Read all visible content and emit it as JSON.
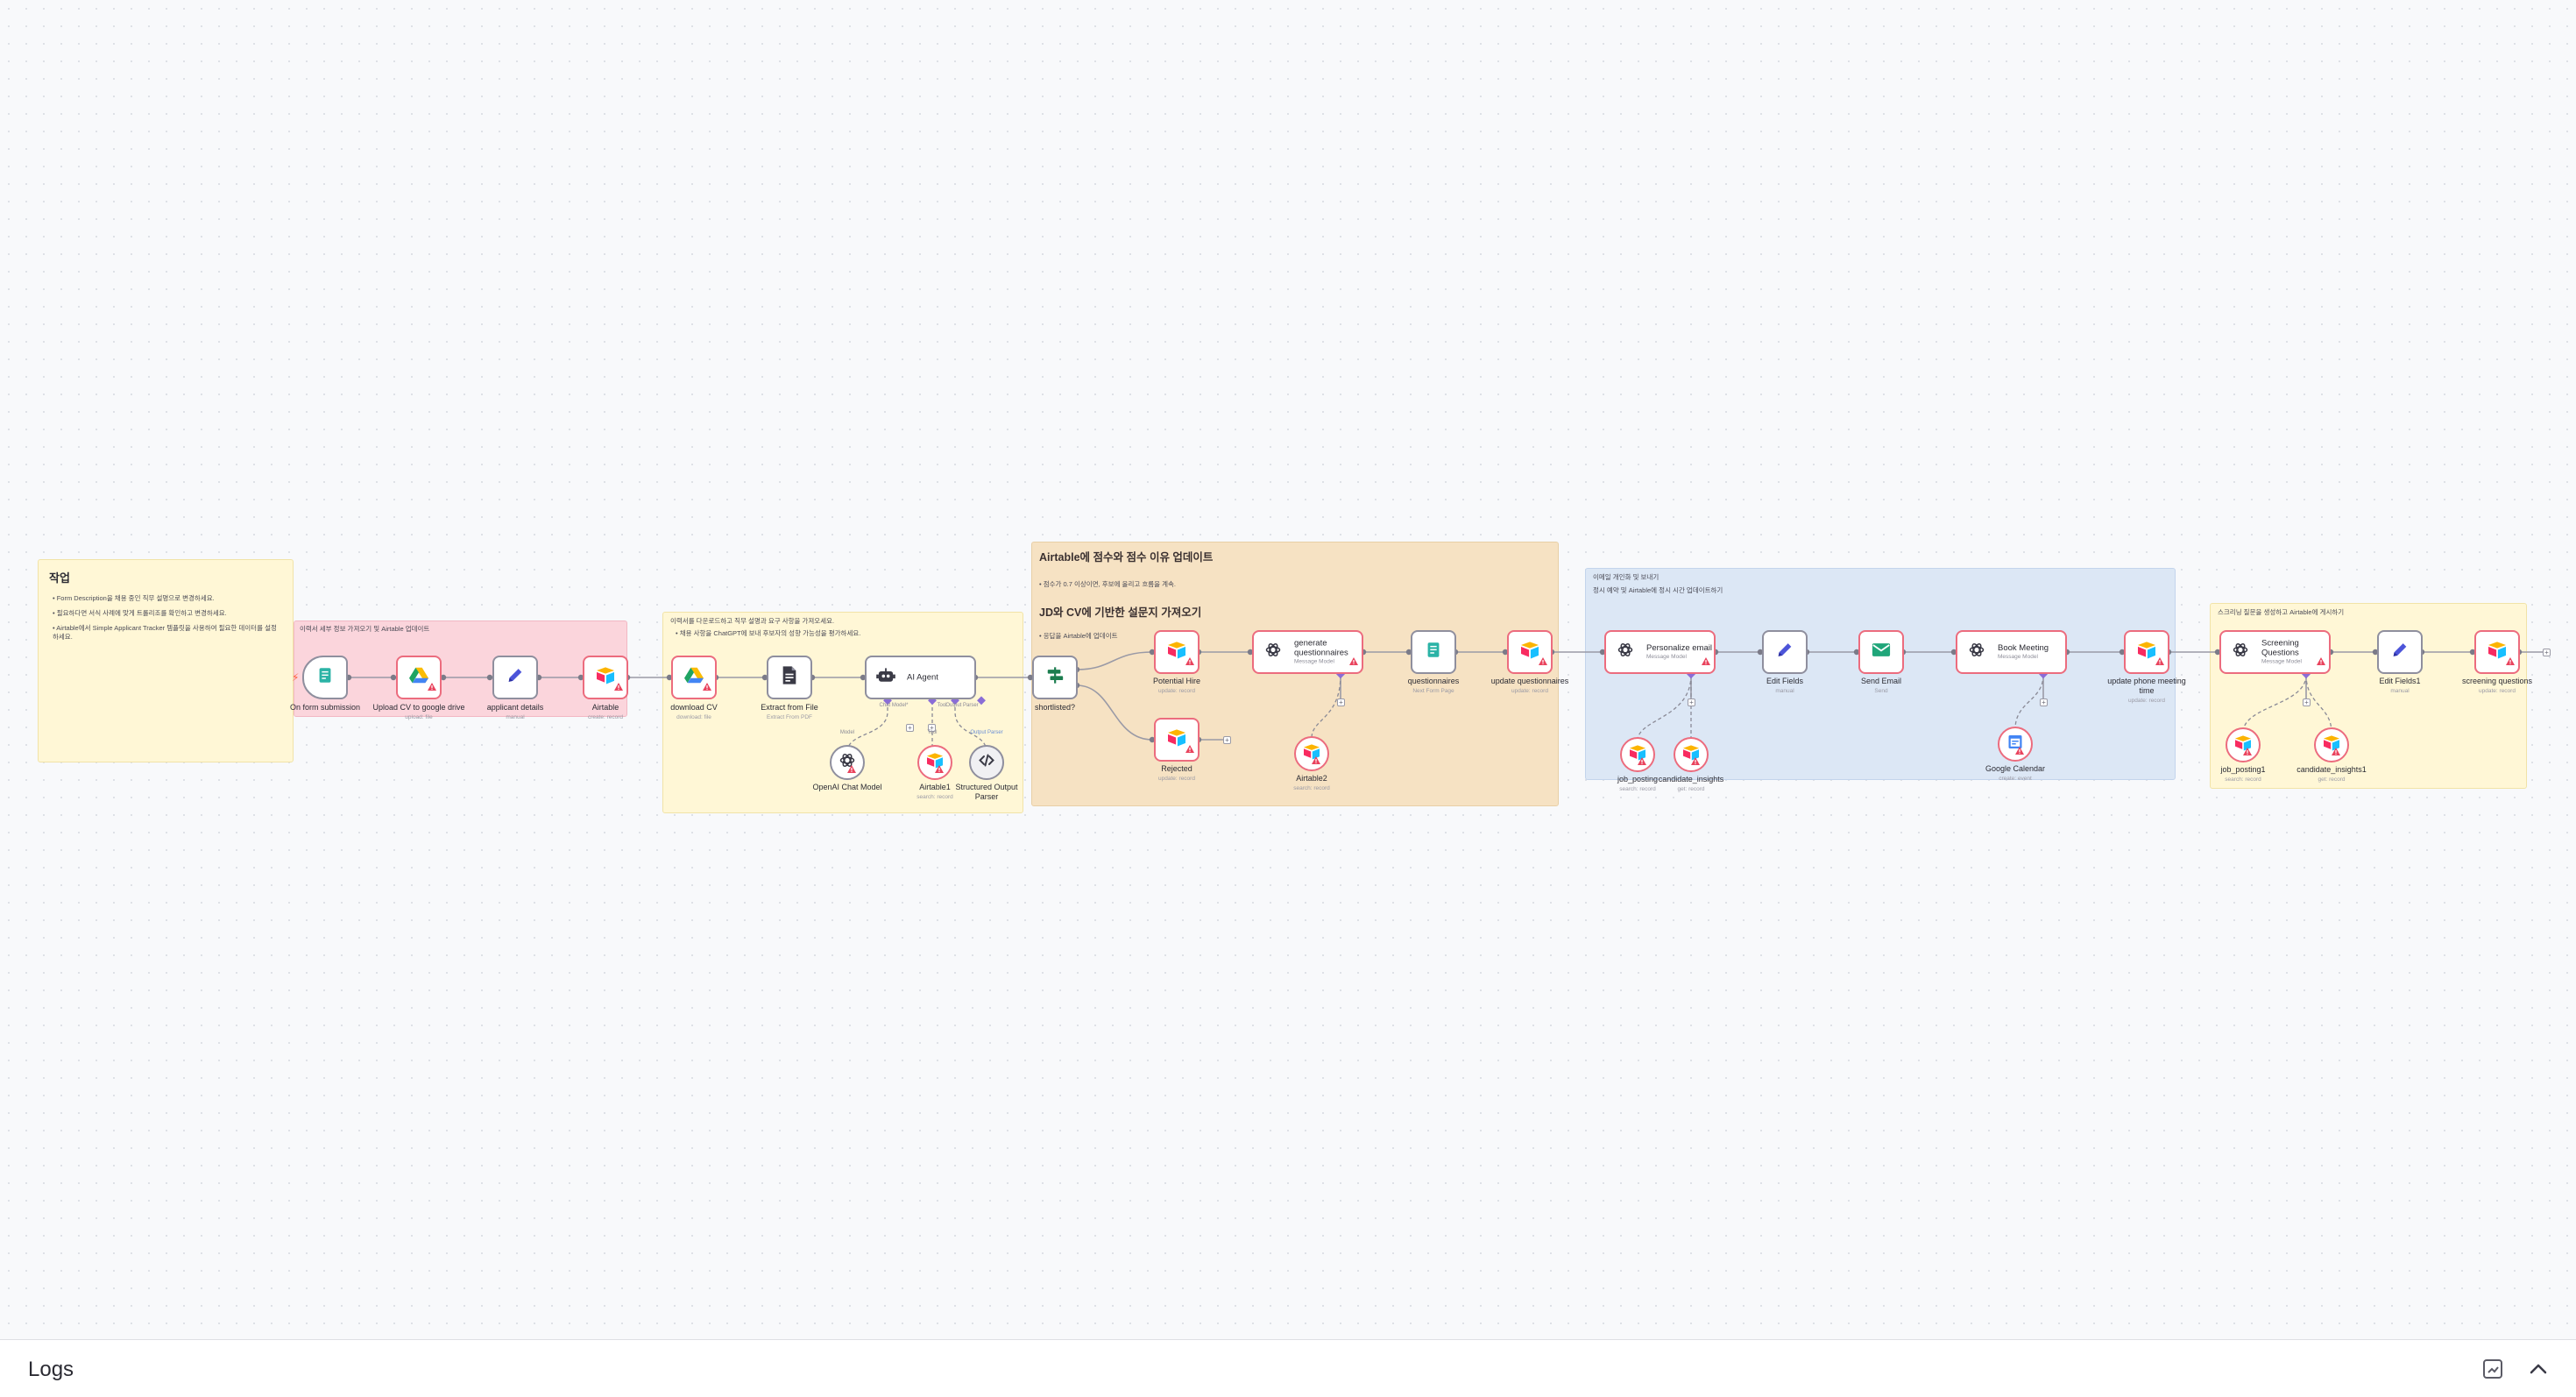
{
  "canvas": {
    "sticky_notes": {
      "s1": {
        "title": "작업",
        "lines": [
          "Form Description을 채용 중인 직무 설명으로 변경하세요.",
          "필요하다면 서식 사례에 맞게 트롤리조를 확인하고 변경하세요.",
          "Airtable에서 Simple Applicant Tracker 템플릿을 사용하여 필요한 데이터를 설정하세요."
        ]
      },
      "s2": {
        "lines": [
          "이력서 세부 정보 가져오기 및 Airtable 업데이트"
        ]
      },
      "s3": {
        "lines": [
          "이력서를 다운로드하고 직무 설명과 요구 사항을 가져오세요.",
          "• 채용 사항을 ChatGPT에 보내 후보자의 성향 가능성을 평가하세요."
        ]
      },
      "s4": {
        "title": "Airtable에 점수와 점수 이유 업데이트",
        "line1": "• 점수가 0.7 이상이면, 후보에 올리고 흐름을 계속.",
        "title2": "JD와 CV에 기반한 설문지 가져오기",
        "line2": "• 응답을 Airtable에 업데이트"
      },
      "s5": {
        "lines": [
          "이메일 개인화 및 보내기",
          "정시 예약 및 Airtable에 정시 시간 업데이트하기"
        ]
      },
      "s6": {
        "lines": [
          "스크리닝 질문을 생성하고 Airtable에 게시하기"
        ]
      }
    },
    "nodes": {
      "on_form": {
        "label": "On form submission",
        "icon": "form-icon"
      },
      "upload_cv": {
        "label": "Upload CV to google drive",
        "sub": "upload: file",
        "icon": "google-drive-icon"
      },
      "applicant_details": {
        "label": "applicant details",
        "sub": "manual",
        "icon": "pencil-icon"
      },
      "airtable": {
        "label": "Airtable",
        "sub": "create: record",
        "icon": "airtable-icon"
      },
      "download_cv": {
        "label": "download CV",
        "sub": "download: file",
        "icon": "google-drive-icon"
      },
      "extract_pdf": {
        "label": "Extract from File",
        "sub": "Extract From PDF",
        "icon": "file-extract-icon"
      },
      "ai_agent": {
        "label": "AI Agent",
        "icon": "robot-icon",
        "port_model": "Chat Model*",
        "port_tool": "Tool",
        "port_output": "Output Parser"
      },
      "openai_chat": {
        "label": "OpenAI Chat Model",
        "icon": "openai-icon",
        "port": "Model"
      },
      "airtable1": {
        "label": "Airtable1",
        "sub": "search: record",
        "icon": "airtable-icon",
        "port": "Tool"
      },
      "parser": {
        "label": "Structured Output Parser",
        "icon": "code-icon",
        "port": "Output Parser"
      },
      "shortlisted": {
        "label": "shortlisted?",
        "icon": "switch-icon"
      },
      "potential_hire": {
        "label": "Potential Hire",
        "sub": "update: record",
        "icon": "airtable-icon"
      },
      "rejected": {
        "label": "Rejected",
        "sub": "update: record",
        "icon": "airtable-icon"
      },
      "gen_questionnaires": {
        "label": "generate questionnaires",
        "sub": "Message Model",
        "icon": "openai-icon"
      },
      "airtable2": {
        "label": "Airtable2",
        "sub": "search: record",
        "icon": "airtable-icon"
      },
      "questionnaires": {
        "label": "questionnaires",
        "sub": "Next Form Page",
        "icon": "form-icon"
      },
      "update_questionnaires": {
        "label": "update questionnaires",
        "sub": "update: record",
        "icon": "airtable-icon"
      },
      "personalize_email": {
        "label": "Personalize email",
        "sub": "Message Model",
        "icon": "openai-icon"
      },
      "job_posting": {
        "label": "job_posting",
        "sub": "search: record",
        "icon": "airtable-icon"
      },
      "candidate_insights": {
        "label": "candidate_insights",
        "sub": "get: record",
        "icon": "airtable-icon"
      },
      "edit_fields": {
        "label": "Edit Fields",
        "sub": "manual",
        "icon": "pencil-icon"
      },
      "send_email": {
        "label": "Send Email",
        "sub": "Send",
        "icon": "email-icon"
      },
      "book_meeting": {
        "label": "Book Meeting",
        "sub": "Message Model",
        "icon": "openai-icon"
      },
      "google_calendar": {
        "label": "Google Calendar",
        "sub": "create: event",
        "icon": "calendar-icon"
      },
      "update_phone": {
        "label": "update phone meeting time",
        "sub": "update: record",
        "icon": "airtable-icon"
      },
      "screening_questions": {
        "label": "Screening Questions",
        "sub": "Message Model",
        "icon": "openai-icon"
      },
      "job_posting1": {
        "label": "job_posting1",
        "sub": "search: record",
        "icon": "airtable-icon"
      },
      "candidate_insights1": {
        "label": "candidate_insights1",
        "sub": "get: record",
        "icon": "airtable-icon"
      },
      "edit_fields1": {
        "label": "Edit Fields1",
        "sub": "manual",
        "icon": "pencil-icon"
      },
      "screening_q": {
        "label": "screening questions",
        "sub": "update: record",
        "icon": "airtable-icon"
      }
    }
  },
  "logs_bar": {
    "title": "Logs",
    "icons": [
      "popout-icon",
      "chevron-up-icon"
    ]
  },
  "colors": {
    "node_border": "#8f8f9e",
    "warning": "#ec6c7e",
    "sticky_yellow": "#fff7d6",
    "sticky_red": "#fbd5dc",
    "sticky_orange": "#f6e2c3",
    "sticky_blue": "#dce7f5"
  }
}
